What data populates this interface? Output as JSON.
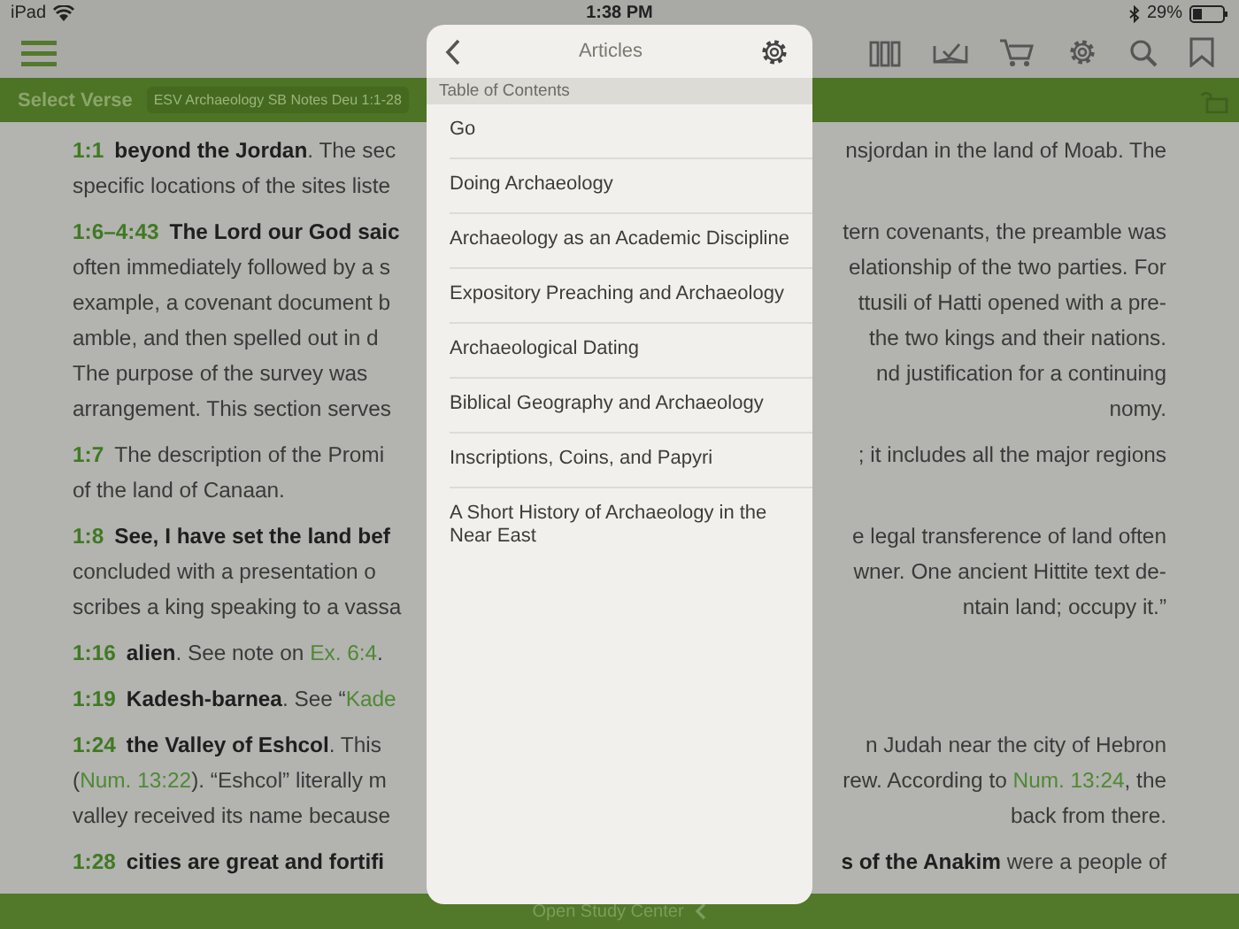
{
  "status_bar": {
    "device": "iPad",
    "time": "1:38 PM",
    "battery": "29%"
  },
  "verse_bar": {
    "label": "Select Verse",
    "resource": "ESV Archaeology SB Notes Deu 1:1-28"
  },
  "notes": [
    {
      "lines": [
        {
          "left": [
            {
              "kind": "ref",
              "text": "1:1"
            },
            {
              "kind": "bold",
              "text": "beyond the Jordan"
            },
            {
              "kind": "plain",
              "text": ". The sec"
            }
          ],
          "right": [
            {
              "kind": "plain",
              "text": "nsjordan in the land of Moab. The"
            }
          ]
        },
        {
          "left": [
            {
              "kind": "plain",
              "text": "specific locations of the sites liste"
            }
          ]
        }
      ]
    },
    {
      "lines": [
        {
          "left": [
            {
              "kind": "ref",
              "text": "1:6–4:43"
            },
            {
              "kind": "bold",
              "text": "The Lord our God saic"
            }
          ],
          "right": [
            {
              "kind": "plain",
              "text": "tern covenants, the preamble was"
            }
          ]
        },
        {
          "left": [
            {
              "kind": "plain",
              "text": "often immediately followed by a s"
            }
          ],
          "right": [
            {
              "kind": "plain",
              "text": "elationship of the two parties. For"
            }
          ]
        },
        {
          "left": [
            {
              "kind": "plain",
              "text": "example, a covenant document b"
            }
          ],
          "right": [
            {
              "kind": "plain",
              "text": "ttusili of Hatti opened with a pre-"
            }
          ]
        },
        {
          "left": [
            {
              "kind": "plain",
              "text": "amble, and then spelled out in d"
            }
          ],
          "right": [
            {
              "kind": "plain",
              "text": "the two kings and their nations."
            }
          ]
        },
        {
          "left": [
            {
              "kind": "plain",
              "text": "The purpose of the survey was"
            }
          ],
          "right": [
            {
              "kind": "plain",
              "text": "nd justification for a continuing"
            }
          ]
        },
        {
          "left": [
            {
              "kind": "plain",
              "text": "arrangement. This section serves"
            }
          ],
          "right": [
            {
              "kind": "plain",
              "text": "nomy."
            }
          ]
        }
      ]
    },
    {
      "lines": [
        {
          "left": [
            {
              "kind": "ref",
              "text": "1:7"
            },
            {
              "kind": "plain",
              "text": "The description of the Promi"
            }
          ],
          "right": [
            {
              "kind": "plain",
              "text": "; it includes all the major regions"
            }
          ]
        },
        {
          "left": [
            {
              "kind": "plain",
              "text": "of the land of Canaan."
            }
          ]
        }
      ]
    },
    {
      "lines": [
        {
          "left": [
            {
              "kind": "ref",
              "text": "1:8"
            },
            {
              "kind": "bold",
              "text": "See, I have set the land bef"
            }
          ],
          "right": [
            {
              "kind": "plain",
              "text": "e legal transference of land often"
            }
          ]
        },
        {
          "left": [
            {
              "kind": "plain",
              "text": "concluded with a presentation o"
            }
          ],
          "right": [
            {
              "kind": "plain",
              "text": "wner. One ancient Hittite text de-"
            }
          ]
        },
        {
          "left": [
            {
              "kind": "plain",
              "text": "scribes a king speaking to a vassa"
            }
          ],
          "right": [
            {
              "kind": "plain",
              "text": "ntain land; occupy it.”"
            }
          ]
        }
      ]
    },
    {
      "lines": [
        {
          "left": [
            {
              "kind": "ref",
              "text": "1:16"
            },
            {
              "kind": "bold",
              "text": "alien"
            },
            {
              "kind": "plain",
              "text": ". See note on "
            },
            {
              "kind": "link",
              "text": "Ex. 6:4"
            },
            {
              "kind": "plain",
              "text": "."
            }
          ]
        }
      ]
    },
    {
      "lines": [
        {
          "left": [
            {
              "kind": "ref",
              "text": "1:19"
            },
            {
              "kind": "bold",
              "text": "Kadesh-barnea"
            },
            {
              "kind": "plain",
              "text": ". See “"
            },
            {
              "kind": "link",
              "text": "Kade"
            }
          ]
        }
      ]
    },
    {
      "lines": [
        {
          "left": [
            {
              "kind": "ref",
              "text": "1:24"
            },
            {
              "kind": "bold",
              "text": "the Valley of Eshcol"
            },
            {
              "kind": "plain",
              "text": ". This"
            }
          ],
          "right": [
            {
              "kind": "plain",
              "text": "n Judah near the city of Hebron"
            }
          ]
        },
        {
          "left": [
            {
              "kind": "plain",
              "text": "("
            },
            {
              "kind": "link",
              "text": "Num. 13:22"
            },
            {
              "kind": "plain",
              "text": "). “Eshcol” literally m"
            }
          ],
          "right": [
            {
              "kind": "plain",
              "text": "rew. According to "
            },
            {
              "kind": "link",
              "text": "Num. 13:24"
            },
            {
              "kind": "plain",
              "text": ", the"
            }
          ]
        },
        {
          "left": [
            {
              "kind": "plain",
              "text": "valley received its name because"
            }
          ],
          "right": [
            {
              "kind": "plain",
              "text": "back from there."
            }
          ]
        }
      ]
    },
    {
      "lines": [
        {
          "left": [
            {
              "kind": "ref",
              "text": "1:28"
            },
            {
              "kind": "bold",
              "text": "cities are great and fortifi"
            }
          ],
          "right": [
            {
              "kind": "bold",
              "text": "s of the Anakim"
            },
            {
              "kind": "plain",
              "text": " were a people of"
            }
          ]
        }
      ]
    }
  ],
  "bottom_bar": {
    "label": "Open Study Center"
  },
  "popover": {
    "title": "Articles",
    "section": "Table of Contents",
    "items": [
      {
        "label": "Go"
      },
      {
        "label": "Doing Archaeology"
      },
      {
        "label": "Archaeology as an Academic Discipline"
      },
      {
        "label": "Expository Preaching and Archaeology"
      },
      {
        "label": "Archaeological Dating"
      },
      {
        "label": "Biblical Geography and Archaeology"
      },
      {
        "label": "Inscriptions, Coins, and Papyri"
      },
      {
        "label": "A Short History of Archaeology in the Near East"
      }
    ]
  }
}
